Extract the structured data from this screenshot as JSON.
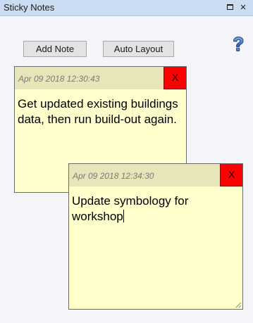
{
  "window": {
    "title": "Sticky Notes",
    "restore_glyph": "restore-icon",
    "close_glyph": "×"
  },
  "toolbar": {
    "add_note_label": "Add Note",
    "auto_layout_label": "Auto Layout",
    "help_icon": "help-icon"
  },
  "notes": [
    {
      "timestamp": "Apr 09 2018 12:30:43",
      "close_label": "X",
      "text": "Get updated existing buildings data, then run build-out again."
    },
    {
      "timestamp": "Apr 09 2018 12:34:30",
      "close_label": "X",
      "text": "Update symbology for workshop"
    }
  ],
  "colors": {
    "titlebar": "#c9dcf1",
    "note_background": "#ffffcc",
    "note_header": "#e8e6b8",
    "note_close": "#ff0000"
  }
}
